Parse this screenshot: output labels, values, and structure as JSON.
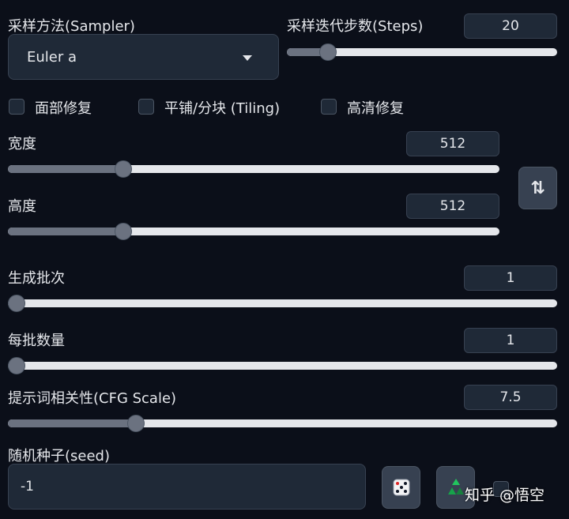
{
  "sampler": {
    "label": "采样方法(Sampler)",
    "value": "Euler a"
  },
  "steps": {
    "label": "采样迭代步数(Steps)",
    "value": "20",
    "min": 1,
    "max": 150,
    "level": 20
  },
  "options": [
    {
      "label": "面部修复",
      "checked": false
    },
    {
      "label": "平铺/分块 (Tiling)",
      "checked": false
    },
    {
      "label": "高清修复",
      "checked": false
    }
  ],
  "width": {
    "label": "宽度",
    "value": "512",
    "min": 64,
    "max": 2048,
    "level": 512
  },
  "height": {
    "label": "高度",
    "value": "512",
    "min": 64,
    "max": 2048,
    "level": 512
  },
  "swap_icon": "⇅",
  "batch_count": {
    "label": "生成批次",
    "value": "1",
    "min": 1,
    "max": 100,
    "level": 1
  },
  "batch_size": {
    "label": "每批数量",
    "value": "1",
    "min": 1,
    "max": 8,
    "level": 1
  },
  "cfg": {
    "label": "提示词相关性(CFG Scale)",
    "value": "7.5",
    "min": 1,
    "max": 30,
    "level": 7.5
  },
  "seed": {
    "label": "随机种子(seed)",
    "value": "-1"
  },
  "watermark": "知乎 @悟空",
  "icons": {
    "dice": "dice-icon",
    "recycle": "recycle-icon",
    "swap": "swap-icon"
  },
  "colors": {
    "background": "#0b0f19",
    "panel": "#1f2937",
    "slider_fill": "#6b7280",
    "track": "#e5e7eb"
  }
}
